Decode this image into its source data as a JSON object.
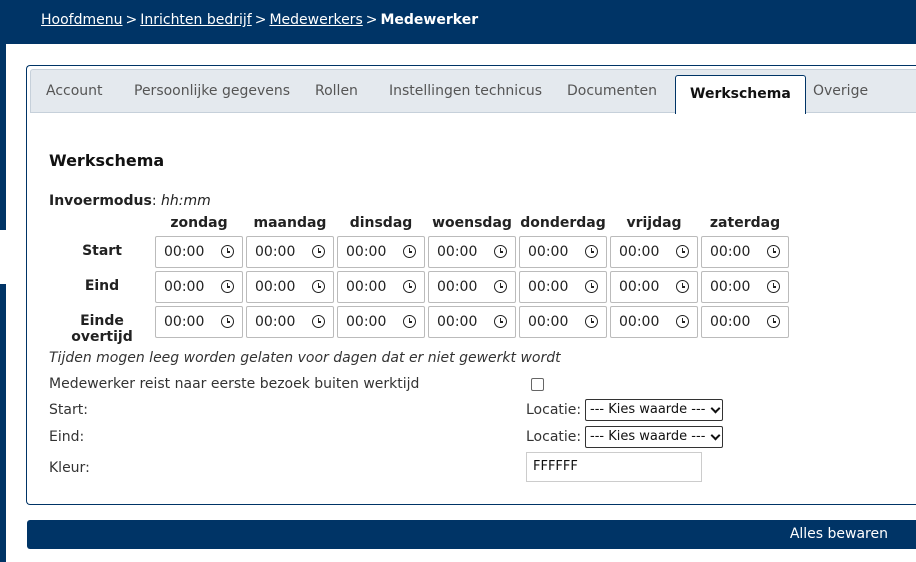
{
  "breadcrumb": {
    "items": [
      "Hoofdmenu",
      "Inrichten bedrijf",
      "Medewerkers"
    ],
    "separator": ">",
    "current": "Medewerker"
  },
  "tabs": [
    {
      "label": "Account"
    },
    {
      "label": "Persoonlijke gegevens"
    },
    {
      "label": "Rollen"
    },
    {
      "label": "Instellingen technicus"
    },
    {
      "label": "Documenten"
    },
    {
      "label": "Werkschema",
      "active": true
    },
    {
      "label": "Overige"
    }
  ],
  "schedule": {
    "title": "Werkschema",
    "mode_label": "Invoermodus",
    "mode_value": "hh:mm",
    "days": [
      "zondag",
      "maandag",
      "dinsdag",
      "woensdag",
      "donderdag",
      "vrijdag",
      "zaterdag"
    ],
    "rows": [
      {
        "label": "Start",
        "values": [
          "00:00",
          "00:00",
          "00:00",
          "00:00",
          "00:00",
          "00:00",
          "00:00"
        ]
      },
      {
        "label": "Eind",
        "values": [
          "00:00",
          "00:00",
          "00:00",
          "00:00",
          "00:00",
          "00:00",
          "00:00"
        ]
      },
      {
        "label": "Einde overtijd",
        "values": [
          "00:00",
          "00:00",
          "00:00",
          "00:00",
          "00:00",
          "00:00",
          "00:00"
        ]
      }
    ],
    "note": "Tijden mogen leeg worden gelaten voor dagen dat er niet gewerkt wordt"
  },
  "travel": {
    "label": "Medewerker reist naar eerste bezoek buiten werktijd",
    "checked": false
  },
  "locations": {
    "start_label": "Start:",
    "end_label": "Eind:",
    "location_label": "Locatie:",
    "start_value": "--- Kies waarde ---",
    "end_value": "--- Kies waarde ---"
  },
  "color": {
    "label": "Kleur:",
    "value": "FFFFFF"
  },
  "save_label": "Alles bewaren",
  "colors": {
    "brand": "#003466",
    "tab_bg": "#e4e9ee"
  }
}
